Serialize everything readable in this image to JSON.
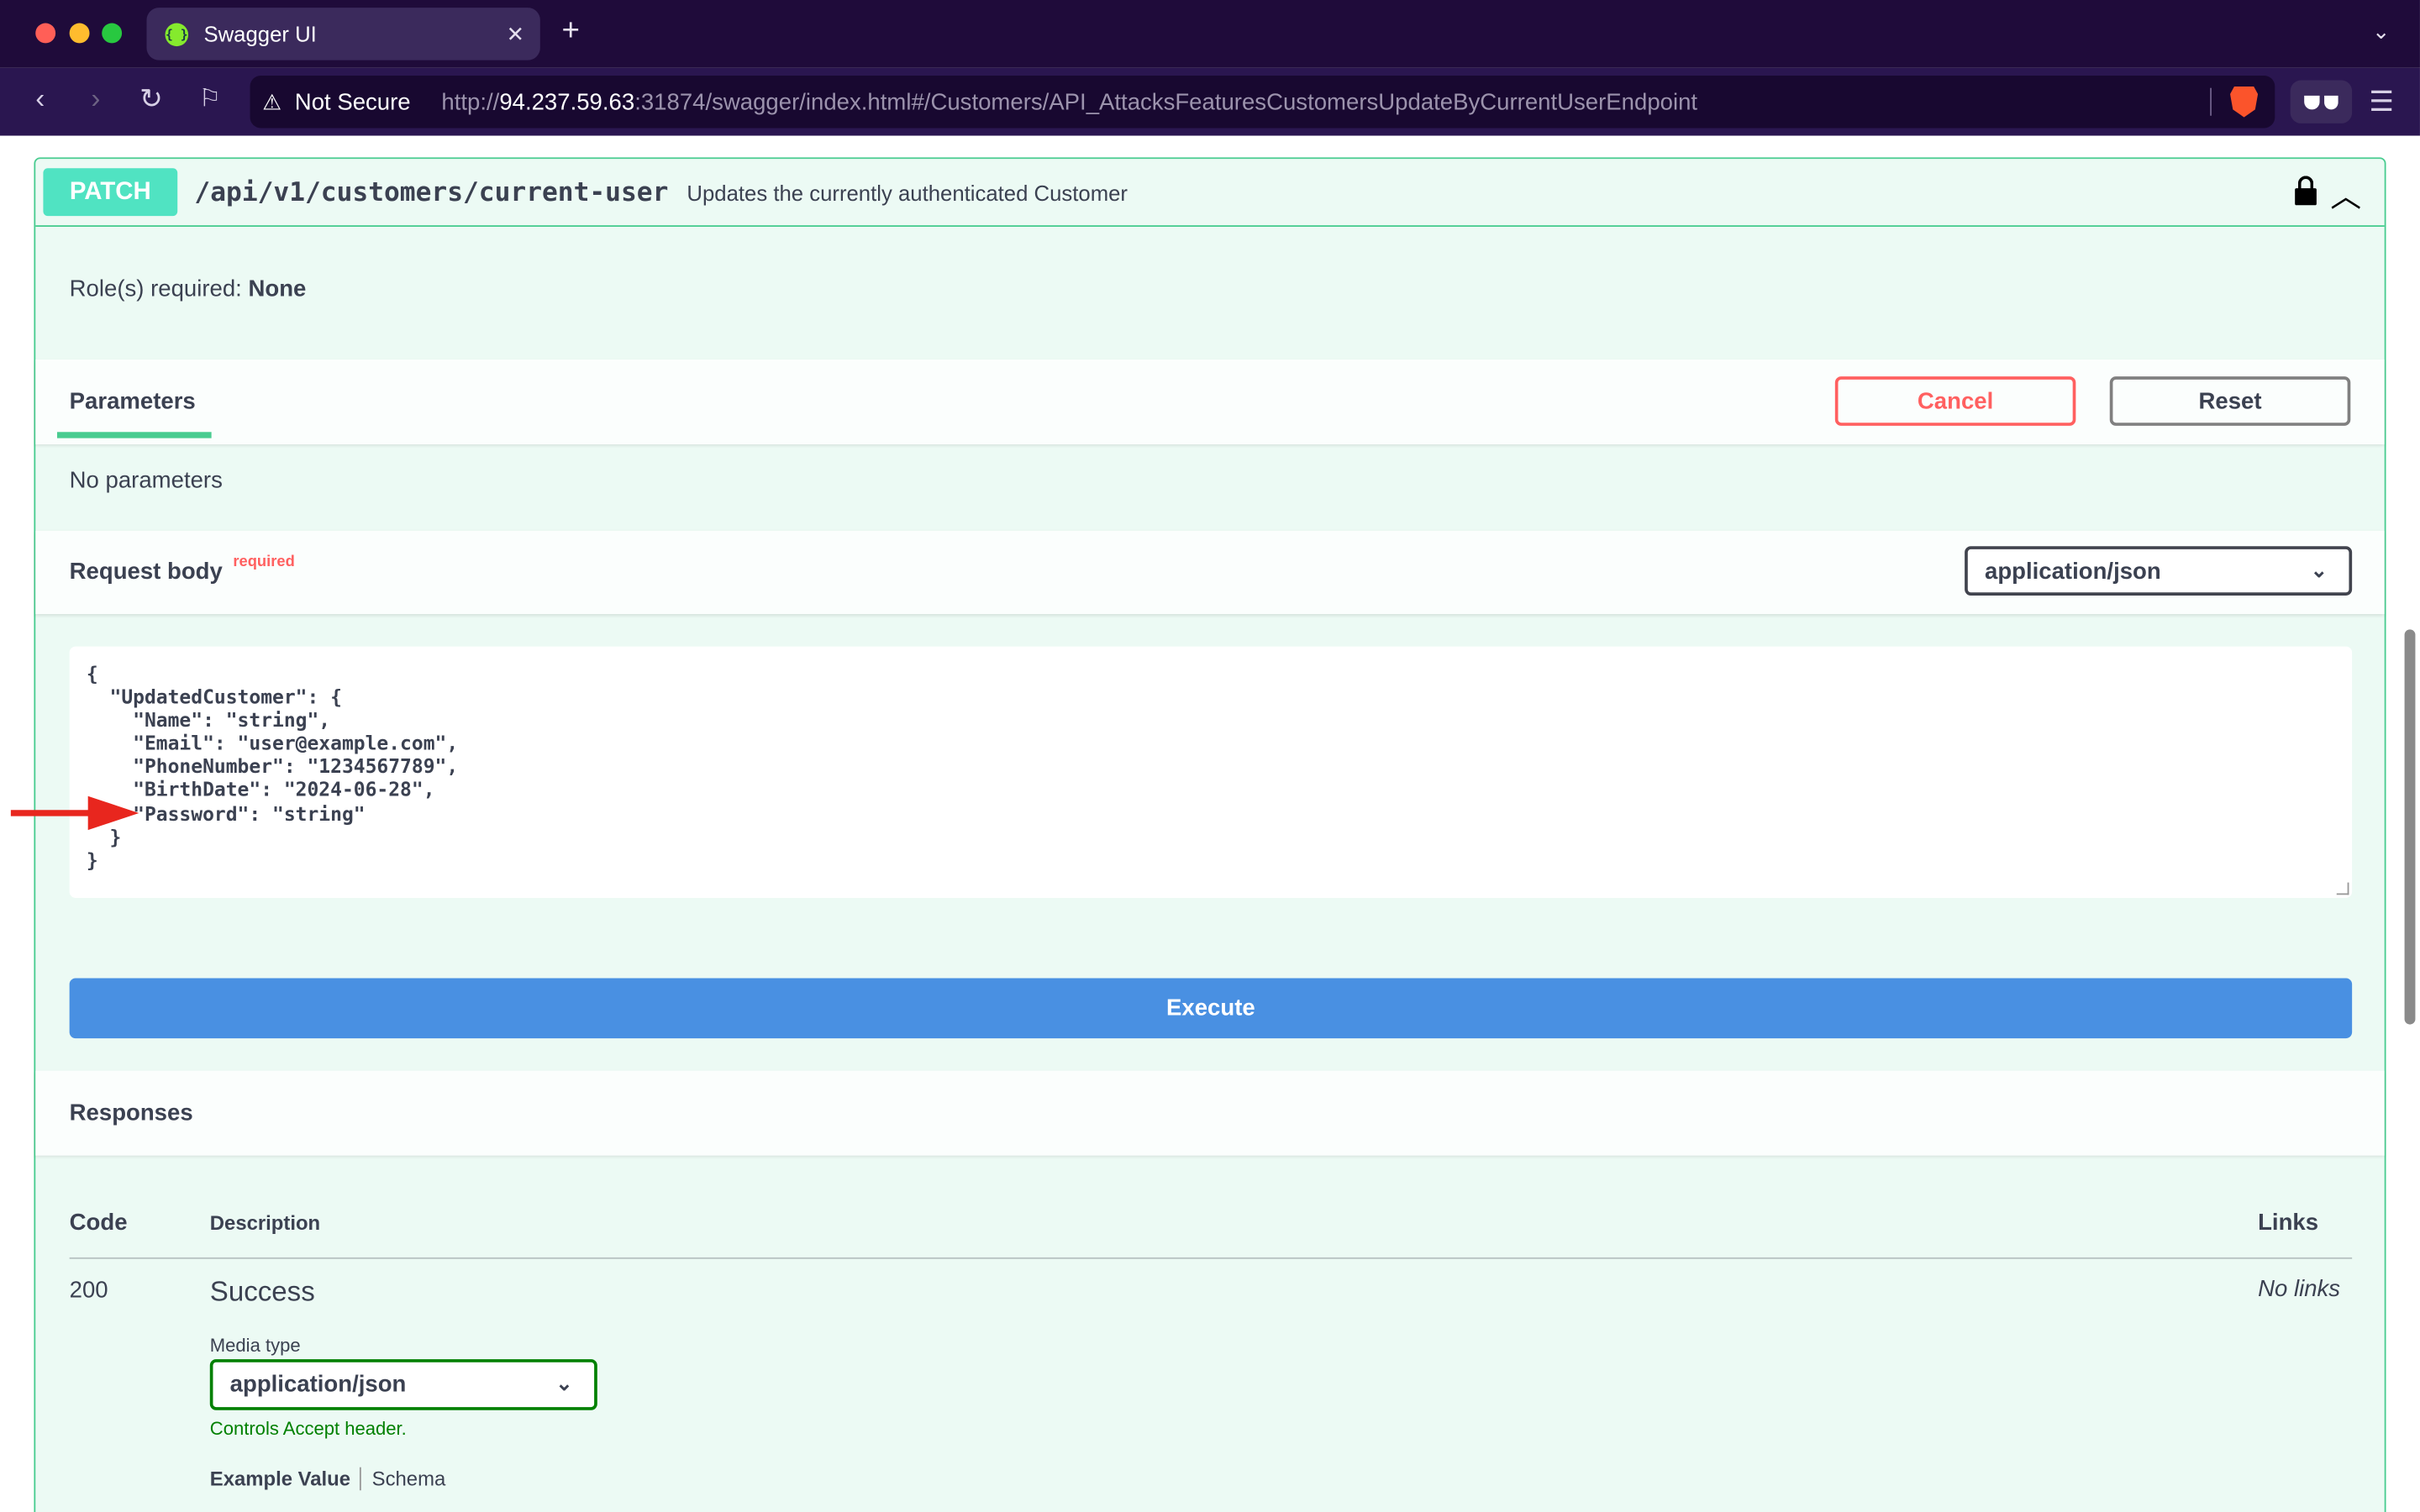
{
  "browser": {
    "tab_title": "Swagger UI",
    "tab_close": "✕",
    "new_tab": "+",
    "security_label": "Not Secure",
    "url_scheme": "http://",
    "url_host": "94.237.59.63",
    "url_rest": ":31874/swagger/index.html#/Customers/API_AttacksFeaturesCustomersUpdateByCurrentUserEndpoint"
  },
  "operation": {
    "method": "PATCH",
    "path": "/api/v1/customers/current-user",
    "summary": "Updates the currently authenticated Customer",
    "roles_label": "Role(s) required:",
    "roles_value": "None"
  },
  "parameters": {
    "tab_label": "Parameters",
    "cancel_label": "Cancel",
    "reset_label": "Reset",
    "empty_text": "No parameters"
  },
  "request_body": {
    "title": "Request body",
    "required_label": "required",
    "content_type": "application/json",
    "body": "{\n  \"UpdatedCustomer\": {\n    \"Name\": \"string\",\n    \"Email\": \"user@example.com\",\n    \"PhoneNumber\": \"1234567789\",\n    \"BirthDate\": \"2024-06-28\",\n    \"Password\": \"string\"\n  }\n}"
  },
  "execute_label": "Execute",
  "responses": {
    "title": "Responses",
    "col_code": "Code",
    "col_description": "Description",
    "col_links": "Links",
    "rows": [
      {
        "code": "200",
        "description": "Success",
        "links": "No links",
        "media_type_label": "Media type",
        "media_type": "application/json",
        "controls_note": "Controls Accept header.",
        "example_tab": "Example Value",
        "schema_tab": "Schema"
      }
    ]
  },
  "colors": {
    "patch": "#50e3c2",
    "border": "#49cc90",
    "execute": "#4990e2",
    "cancel": "#ff6060",
    "annotation_arrow": "#e8261e"
  }
}
